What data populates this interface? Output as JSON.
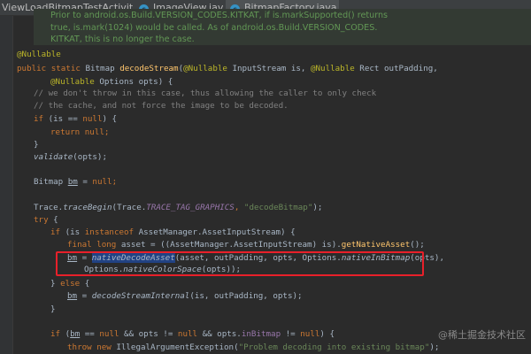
{
  "tabs": [
    {
      "label": "ViewLoadBitmapTestActivity.java",
      "active": false,
      "closable": false
    },
    {
      "label": "ImageView.java",
      "active": false,
      "closable": true
    },
    {
      "label": "BitmapFactory.java",
      "active": true,
      "closable": true
    }
  ],
  "tab_icon_letter": "c",
  "tab_close_glyph": "×",
  "code": {
    "doc_line1": "Prior to android.os.Build.VERSION_CODES.KITKAT, if is.markSupported() returns",
    "doc_line2": "true, is.mark(1024) would be called. As of android.os.Build.VERSION_CODES.",
    "doc_line3": "KITKAT, this is no longer the case.",
    "annotation": "@Nullable",
    "sig1_kw": "public static ",
    "sig1_type": "Bitmap ",
    "sig1_name": "decodeStream",
    "sig1_open": "(",
    "sig1_ann1": "@Nullable",
    "sig1_p1": " InputStream is, ",
    "sig1_ann2": "@Nullable",
    "sig1_p2": " Rect outPadding,",
    "sig2_ann": "@Nullable",
    "sig2_rest": " Options opts) {",
    "c1": "// we don't throw in this case, thus allowing the caller to only check",
    "c2": "// the cache, and not force the image to be decoded.",
    "l_if": "if",
    "l_if_rest": " (is == ",
    "l_null": "null",
    "l_if_end": ") {",
    "l_return": "return ",
    "l_return_null": "null",
    "semi": ";",
    "close_brace": "}",
    "validate_name": "validate",
    "validate_args": "(opts);",
    "bm_type": "Bitmap ",
    "bm_var": "bm",
    "bm_assign": " = ",
    "bm_null": "null",
    "trace_pre": "Trace.",
    "trace_fn": "traceBegin",
    "trace_open": "(Trace.",
    "trace_const": "TRACE_TAG_GRAPHICS",
    "trace_comma": ", ",
    "trace_str": "\"decodeBitmap\"",
    "trace_end": ");",
    "try_kw": "try",
    "try_brace": " {",
    "if2_kw": "if",
    "if2_a": " (is ",
    "if2_instanceof": "instanceof",
    "if2_b": " AssetManager.AssetInputStream) {",
    "final_kw": "final long",
    "final_a": " asset = ((AssetManager.AssetInputStream) is).",
    "final_fn": "getNativeAsset",
    "final_end": "();",
    "nd_var": "bm",
    "nd_eq": " = ",
    "nd_fn": "nativeDecodeAsset",
    "nd_args": "(asset, outPadding, opts, Options.",
    "nd_inbitmap": "nativeInBitmap",
    "nd_args2": "(opts),",
    "cs_pre": "Options.",
    "cs_fn": "nativeColorSpace",
    "cs_end": "(opts));",
    "else_a": "} ",
    "else_kw": "else",
    "else_b": " {",
    "dsi_var": "bm",
    "dsi_eq": " = ",
    "dsi_fn": "decodeStreamInternal",
    "dsi_args": "(is, outPadding, opts);",
    "if3_kw": "if",
    "if3_a": " (",
    "if3_bm": "bm",
    "if3_b": " == ",
    "if3_null1": "null",
    "if3_c": " && opts != ",
    "if3_null2": "null",
    "if3_d": " && opts.",
    "if3_field": "inBitmap",
    "if3_e": " != ",
    "if3_null3": "null",
    "if3_f": ") {",
    "throw_kw": "throw new",
    "throw_a": " IllegalArgumentException(",
    "throw_str": "\"Problem decoding into existing bitmap\"",
    "throw_end": ");"
  },
  "watermark": "@稀土掘金技术社区",
  "colors": {
    "editor_bg": "#2b2b2b",
    "keyword": "#cc7832",
    "annotation": "#bbb529",
    "method_decl": "#ffc66d",
    "string": "#6a8759",
    "comment": "#808080",
    "doc": "#629755",
    "constant": "#9876aa",
    "highlight_box": "#e8202a"
  }
}
